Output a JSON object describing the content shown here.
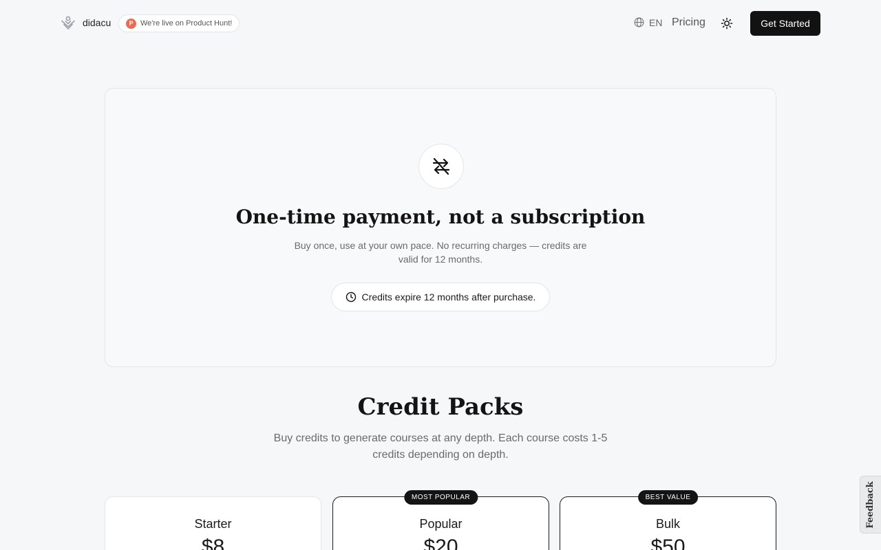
{
  "header": {
    "brand_name": "didacu",
    "product_hunt_badge": "We're live on Product Hunt!",
    "product_hunt_letter": "P",
    "language": "EN",
    "nav_pricing": "Pricing",
    "cta_label": "Get Started"
  },
  "hero": {
    "title": "One-time payment, not a subscription",
    "subtitle": "Buy once, use at your own pace. No recurring charges — credits are valid for 12 months.",
    "notice": "Credits expire 12 months after purchase."
  },
  "packs": {
    "title": "Credit Packs",
    "subtitle": "Buy credits to generate courses at any depth. Each course costs 1-5 credits depending on depth.",
    "items": [
      {
        "name": "Starter",
        "price": "$8",
        "badge": ""
      },
      {
        "name": "Popular",
        "price": "$20",
        "badge": "MOST POPULAR"
      },
      {
        "name": "Bulk",
        "price": "$50",
        "badge": "BEST VALUE"
      }
    ]
  },
  "feedback_label": "Feedback",
  "colors": {
    "background": "#f6f7f9",
    "cta": "#121212",
    "product_hunt": "#ec6a4f",
    "border": "#e3e5e8"
  },
  "icons": [
    "didacu-logo-icon",
    "product-hunt-icon",
    "globe-icon",
    "sun-icon",
    "repeat-off-icon",
    "clock-icon"
  ]
}
